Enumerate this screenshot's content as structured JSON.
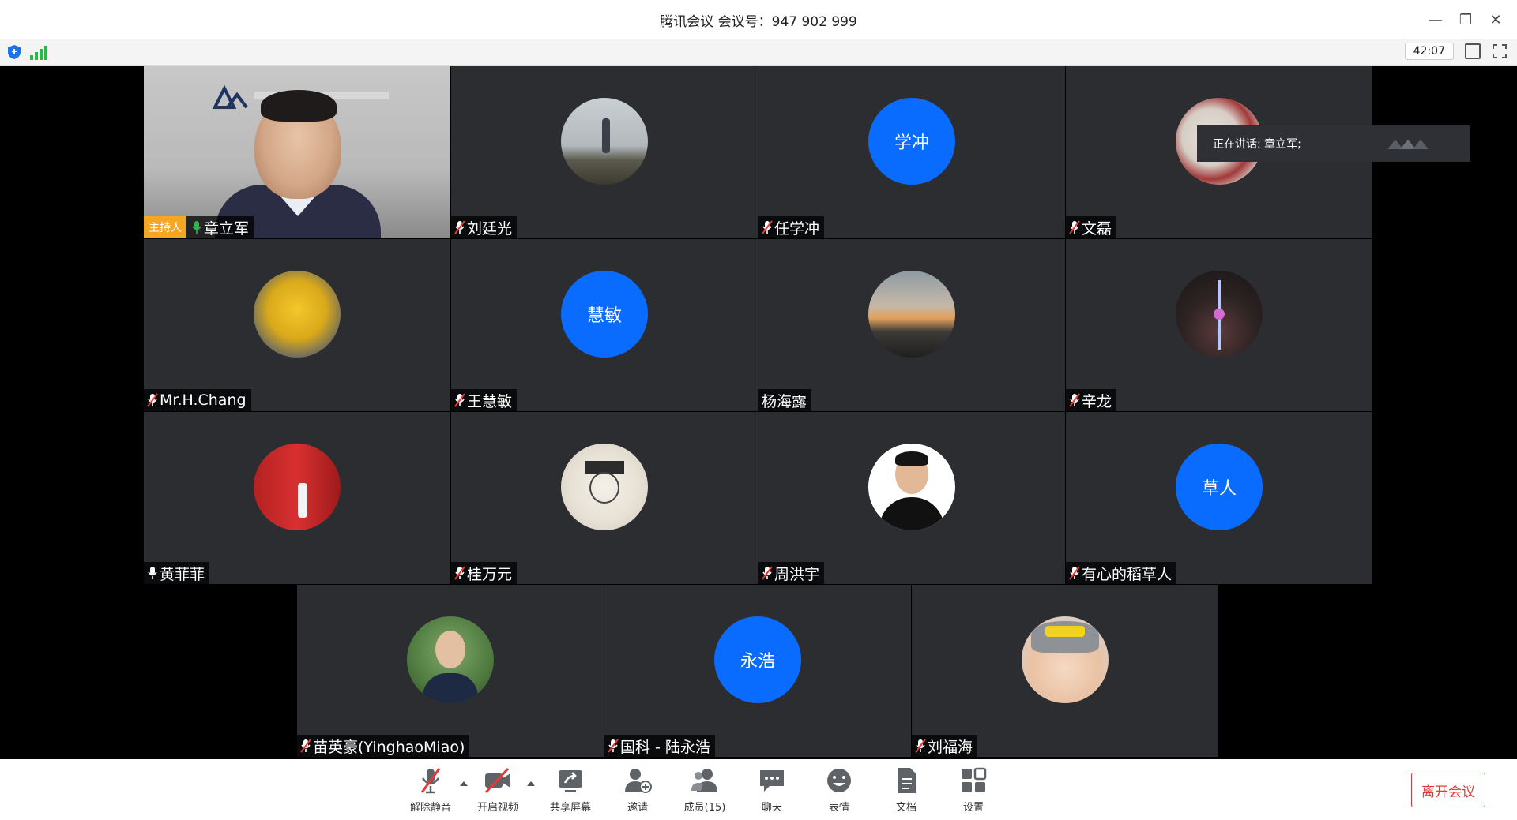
{
  "window": {
    "title": "腾讯会议 会议号：947 902 999"
  },
  "status": {
    "timer": "42:07"
  },
  "host_badge": "主持人",
  "speaking_banner": "正在讲话: 章立军;",
  "participants": [
    {
      "name": "章立军",
      "type": "video",
      "mic": "on",
      "host": true
    },
    {
      "name": "刘廷光",
      "type": "photo",
      "mic": "muted",
      "photo": "seaside-person"
    },
    {
      "name": "任学冲",
      "type": "text",
      "mic": "muted",
      "initials": "学冲"
    },
    {
      "name": "文磊",
      "type": "photo",
      "mic": "muted",
      "photo": "hand-print"
    },
    {
      "name": "Mr.H.Chang",
      "type": "photo",
      "mic": "muted",
      "photo": "yellow-robot"
    },
    {
      "name": "王慧敏",
      "type": "text",
      "mic": "muted",
      "initials": "慧敏"
    },
    {
      "name": "杨海露",
      "type": "photo",
      "mic": "none",
      "photo": "sunset"
    },
    {
      "name": "辛龙",
      "type": "photo",
      "mic": "muted",
      "photo": "tv-tower-night"
    },
    {
      "name": "黄菲菲",
      "type": "photo",
      "mic": "on",
      "photo": "red-door"
    },
    {
      "name": "桂万元",
      "type": "photo",
      "mic": "muted",
      "photo": "sketch-graduate"
    },
    {
      "name": "周洪宇",
      "type": "photo",
      "mic": "muted",
      "photo": "portrait-man"
    },
    {
      "name": "有心的稻草人",
      "type": "text",
      "mic": "muted",
      "initials": "草人"
    },
    {
      "name": "苗英豪(YinghaoMiao)",
      "type": "photo",
      "mic": "muted",
      "photo": "man-glasses"
    },
    {
      "name": "国科 - 陆永浩",
      "type": "text",
      "mic": "muted",
      "initials": "永浩"
    },
    {
      "name": "刘福海",
      "type": "photo",
      "mic": "muted",
      "photo": "baby-cap"
    }
  ],
  "toolbar": {
    "unmute": "解除静音",
    "video": "开启视频",
    "share": "共享屏幕",
    "invite": "邀请",
    "members": "成员(15)",
    "chat": "聊天",
    "emoji": "表情",
    "docs": "文档",
    "settings": "设置",
    "leave": "离开会议"
  },
  "colors": {
    "accent": "#0a6cff",
    "host_badge": "#f5a623",
    "leave": "#e53935",
    "mic_muted": "#e53935",
    "mic_on": "#2db74a"
  }
}
